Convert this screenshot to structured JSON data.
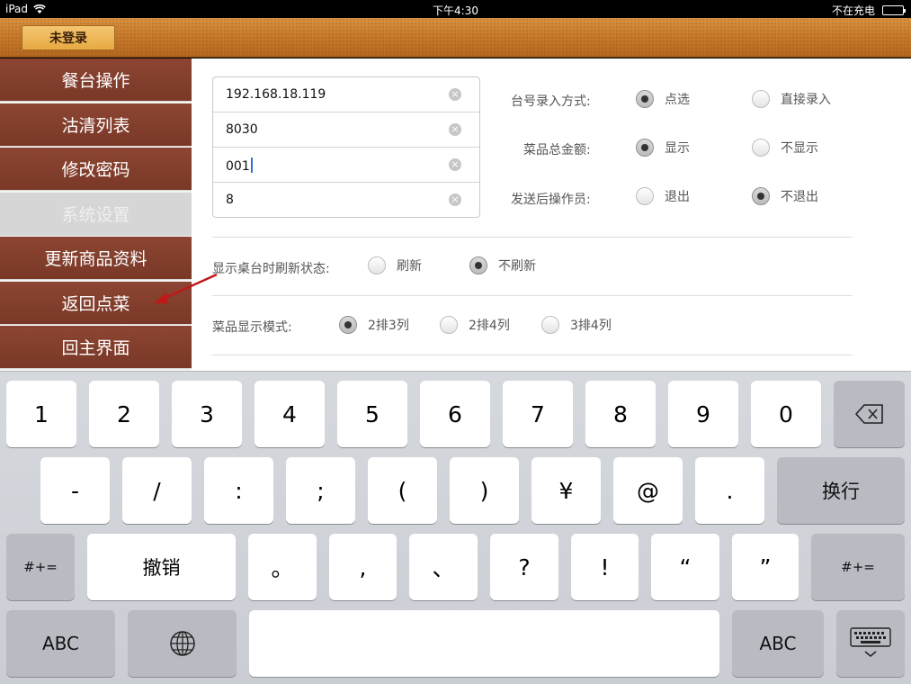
{
  "status": {
    "device": "iPad",
    "time": "下午4:30",
    "charging": "不在充电"
  },
  "header": {
    "login_button": "未登录"
  },
  "sidebar": {
    "items": [
      {
        "label": "餐台操作"
      },
      {
        "label": "沽清列表"
      },
      {
        "label": "修改密码"
      },
      {
        "label": "系统设置",
        "selected": true
      },
      {
        "label": "更新商品资料"
      },
      {
        "label": "返回点菜"
      },
      {
        "label": "回主界面"
      }
    ]
  },
  "inputs": [
    {
      "value": "192.168.18.119"
    },
    {
      "value": "8030"
    },
    {
      "value": "001",
      "focused": true
    },
    {
      "value": "8"
    }
  ],
  "settings": {
    "table_input": {
      "label": "台号录入方式:",
      "options": [
        "点选",
        "直接录入"
      ],
      "selected": 0
    },
    "dish_total": {
      "label": "菜品总金额:",
      "options": [
        "显示",
        "不显示"
      ],
      "selected": 0
    },
    "after_send": {
      "label": "发送后操作员:",
      "options": [
        "退出",
        "不退出"
      ],
      "selected": 1
    },
    "refresh_state": {
      "label": "显示桌台时刷新状态:",
      "options": [
        "刷新",
        "不刷新"
      ],
      "selected": 1
    },
    "display_mode": {
      "label": "菜品显示模式:",
      "options": [
        "2排3列",
        "2排4列",
        "3排4列"
      ],
      "selected": 0
    }
  },
  "keyboard": {
    "row1": [
      "1",
      "2",
      "3",
      "4",
      "5",
      "6",
      "7",
      "8",
      "9",
      "0"
    ],
    "row2": [
      "-",
      "/",
      ":",
      ";",
      "(",
      ")",
      "¥",
      "@",
      "."
    ],
    "return": "换行",
    "row3": [
      "。",
      ",",
      "、",
      "?",
      "!",
      "“",
      "”"
    ],
    "symbols": "#+=",
    "undo": "撤销",
    "abc": "ABC"
  },
  "colors": {
    "sidebar": "#7f3c2b",
    "header": "#c87b2b",
    "login_button": "#e7aa44"
  }
}
